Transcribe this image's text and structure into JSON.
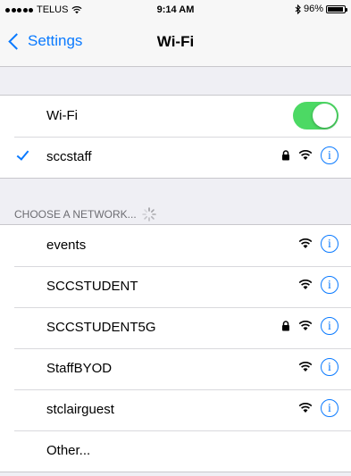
{
  "status_bar": {
    "carrier": "TELUS",
    "time": "9:14 AM",
    "battery": "96%",
    "battery_level": 0.96
  },
  "nav": {
    "back_label": "Settings",
    "title": "Wi-Fi"
  },
  "wifi": {
    "label": "Wi-Fi",
    "enabled": true,
    "toggle_color": "#4cd964"
  },
  "connected": {
    "name": "sccstaff",
    "secured": true
  },
  "section": {
    "header": "CHOOSE A NETWORK..."
  },
  "networks": [
    {
      "name": "events",
      "secured": false
    },
    {
      "name": "SCCSTUDENT",
      "secured": false
    },
    {
      "name": "SCCSTUDENT5G",
      "secured": true
    },
    {
      "name": "StaffBYOD",
      "secured": false
    },
    {
      "name": "stclairguest",
      "secured": false
    }
  ],
  "other": {
    "label": "Other..."
  },
  "icons": {
    "info": "i",
    "info_icon_name": "info-icon",
    "wifi_icon_name": "wifi-signal-icon",
    "lock_icon_name": "lock-icon"
  },
  "colors": {
    "accent": "#0a7aff",
    "background": "#efeff4"
  }
}
